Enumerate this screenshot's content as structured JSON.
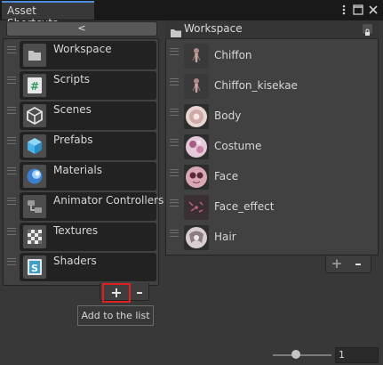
{
  "window": {
    "tab_title": "Asset Shortcuts",
    "controls": [
      "more-icon",
      "maximize-icon",
      "close-icon"
    ]
  },
  "left_panel": {
    "back_label": "<",
    "items": [
      {
        "label": "Workspace",
        "icon": "folder-icon"
      },
      {
        "label": "Scripts",
        "icon": "script-icon"
      },
      {
        "label": "Scenes",
        "icon": "unity-scene-icon"
      },
      {
        "label": "Prefabs",
        "icon": "prefab-icon"
      },
      {
        "label": "Materials",
        "icon": "material-icon"
      },
      {
        "label": "Animator Controllers",
        "icon": "animator-controller-icon"
      },
      {
        "label": "Textures",
        "icon": "texture-icon"
      },
      {
        "label": "Shaders",
        "icon": "shader-icon"
      }
    ],
    "add_label": "+",
    "remove_label": "–",
    "tooltip": "Add to the list"
  },
  "right_panel": {
    "header": "Workspace",
    "items": [
      {
        "label": "Chiffon",
        "icon": "avatar-thumbnail-icon"
      },
      {
        "label": "Chiffon_kisekae",
        "icon": "avatar-thumbnail-icon"
      },
      {
        "label": "Body",
        "icon": "texture-thumbnail-icon"
      },
      {
        "label": "Costume",
        "icon": "texture-thumbnail-icon"
      },
      {
        "label": "Face",
        "icon": "texture-thumbnail-icon"
      },
      {
        "label": "Face_effect",
        "icon": "texture-thumbnail-icon"
      },
      {
        "label": "Hair",
        "icon": "texture-thumbnail-icon"
      }
    ],
    "add_label": "+",
    "remove_label": "–"
  },
  "bottom_bar": {
    "zoom_value": "1",
    "zoom_slider_fraction": 0.4
  },
  "colors": {
    "tab_accent": "#4c8bd6",
    "highlight_box": "#e02020",
    "script_icon": "#2f9a5c",
    "scene_icon": "#5a5a5a",
    "prefab_icon": "#49b6ea",
    "material_icon": "#3b7fd1",
    "shader_icon": "#3da0c9"
  }
}
